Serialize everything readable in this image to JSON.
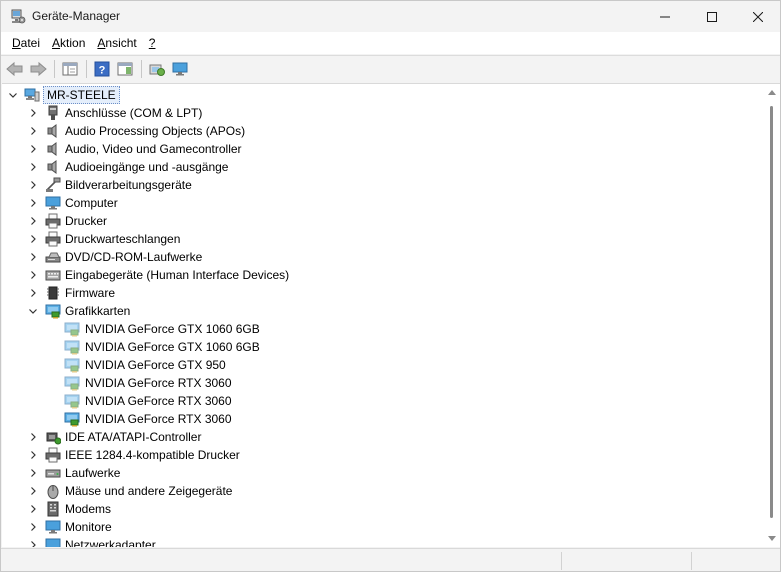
{
  "window": {
    "title": "Geräte-Manager"
  },
  "menu": [
    {
      "label": "Datei",
      "accel": "D",
      "rest": "atei"
    },
    {
      "label": "Aktion",
      "accel": "A",
      "rest": "ktion"
    },
    {
      "label": "Ansicht",
      "accel": "A",
      "rest": "nsicht"
    },
    {
      "label": "?",
      "accel": "?",
      "rest": ""
    }
  ],
  "toolbar": {
    "buttons": [
      "back-arrow-icon",
      "forward-arrow-icon",
      "properties-sheet-icon",
      "help-icon",
      "details-pane-icon",
      "scan-hardware-icon",
      "monitor-icon"
    ]
  },
  "tree": {
    "root": {
      "label": "MR-STEELE",
      "icon": "computer-icon"
    },
    "nodes": [
      {
        "label": "Anschlüsse (COM & LPT)",
        "icon": "port-icon",
        "expanded": false
      },
      {
        "label": "Audio Processing Objects (APOs)",
        "icon": "speaker-icon",
        "expanded": false
      },
      {
        "label": "Audio, Video und Gamecontroller",
        "icon": "speaker-icon",
        "expanded": false
      },
      {
        "label": "Audioeingänge und -ausgänge",
        "icon": "speaker-icon",
        "expanded": false
      },
      {
        "label": "Bildverarbeitungsgeräte",
        "icon": "camera-icon",
        "expanded": false
      },
      {
        "label": "Computer",
        "icon": "monitor-icon",
        "expanded": false
      },
      {
        "label": "Drucker",
        "icon": "printer-icon",
        "expanded": false
      },
      {
        "label": "Druckwarteschlangen",
        "icon": "printer-icon",
        "expanded": false
      },
      {
        "label": "DVD/CD-ROM-Laufwerke",
        "icon": "disc-drive-icon",
        "expanded": false
      },
      {
        "label": "Eingabegeräte (Human Interface Devices)",
        "icon": "keyboard-icon",
        "expanded": false
      },
      {
        "label": "Firmware",
        "icon": "chip-icon",
        "expanded": false
      },
      {
        "label": "Grafikkarten",
        "icon": "display-adapter-icon",
        "expanded": true,
        "children": [
          {
            "label": "NVIDIA GeForce GTX 1060 6GB",
            "icon": "display-adapter-icon",
            "disabled": true
          },
          {
            "label": "NVIDIA GeForce GTX 1060 6GB",
            "icon": "display-adapter-icon",
            "disabled": true
          },
          {
            "label": "NVIDIA GeForce GTX 950",
            "icon": "display-adapter-icon",
            "disabled": true
          },
          {
            "label": "NVIDIA GeForce RTX 3060",
            "icon": "display-adapter-icon",
            "disabled": true
          },
          {
            "label": "NVIDIA GeForce RTX 3060",
            "icon": "display-adapter-icon",
            "disabled": true
          },
          {
            "label": "NVIDIA GeForce RTX 3060",
            "icon": "display-adapter-icon",
            "disabled": false
          }
        ]
      },
      {
        "label": "IDE ATA/ATAPI-Controller",
        "icon": "ide-controller-icon",
        "expanded": false
      },
      {
        "label": "IEEE 1284.4-kompatible Drucker",
        "icon": "printer-icon",
        "expanded": false
      },
      {
        "label": "Laufwerke",
        "icon": "disk-drive-icon",
        "expanded": false
      },
      {
        "label": "Mäuse und andere Zeigegeräte",
        "icon": "mouse-icon",
        "expanded": false
      },
      {
        "label": "Modems",
        "icon": "modem-icon",
        "expanded": false
      },
      {
        "label": "Monitore",
        "icon": "monitor-icon",
        "expanded": false
      },
      {
        "label": "Netzwerkadapter",
        "icon": "network-adapter-icon",
        "expanded": false
      }
    ]
  },
  "colors": {
    "selection": "#e4eefb",
    "monitor_blue": "#3a9ad9",
    "gpu_green": "#3f9b2f"
  }
}
